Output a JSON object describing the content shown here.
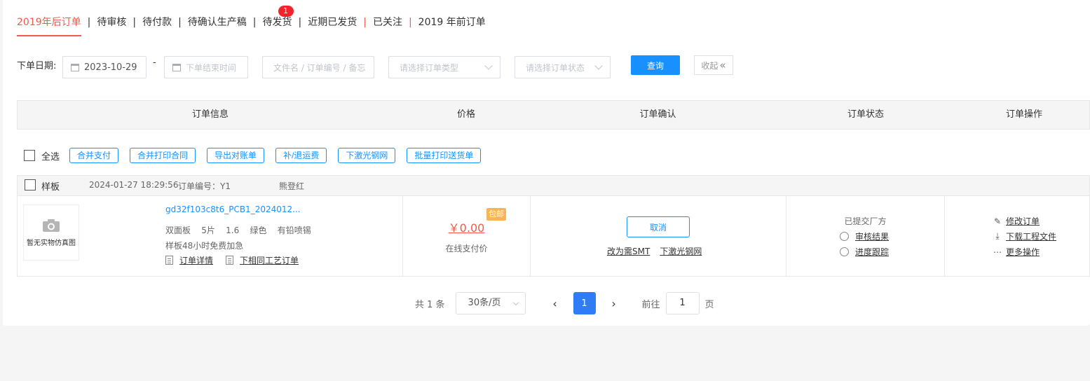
{
  "tabs": [
    {
      "label": "2019年后订单"
    },
    {
      "label": "待审核"
    },
    {
      "label": "待付款"
    },
    {
      "label": "待确认生产稿"
    },
    {
      "label": "待发货",
      "badge": "1"
    },
    {
      "label": "近期已发货"
    },
    {
      "label": "已关注"
    },
    {
      "label": "2019 年前订单"
    }
  ],
  "filters": {
    "date_label": "下单日期:",
    "start_date": "2023-10-29",
    "date_separator": "-",
    "end_placeholder": "下单结束时间",
    "keyword_placeholder": "文件名 / 订单编号 / 备忘",
    "order_type_placeholder": "请选择订单类型",
    "order_status_placeholder": "请选择订单状态",
    "query_label": "查询",
    "collapse_label": "收起"
  },
  "table": {
    "headers": [
      "订单信息",
      "价格",
      "订单确认",
      "订单状态",
      "订单操作"
    ]
  },
  "toolbar": {
    "select_all": "全选",
    "buttons": [
      "合并支付",
      "合并打印合同",
      "导出对账单",
      "补/退运费",
      "下激光钢网",
      "批量打印送货单"
    ]
  },
  "order": {
    "type": "样板",
    "datetime": "2024-01-27 18:29:56",
    "order_no": "订单编号：Y1",
    "owner": "熊登红",
    "thumb_text": "暂无实物仿真图",
    "product_name": "gd32f103c8t6_PCB1_2024012...",
    "spec": "双面板    5片    1.6    绿色    有铅喷锡",
    "note": "样板48小时免费加急",
    "detail_link": "订单详情",
    "same_process_link": "下相同工艺订单",
    "price": "￥0.00",
    "free_shipping_badge": "包邮",
    "pay_method": "在线支付价",
    "cancel_label": "取消",
    "to_smt_link": "改为需SMT",
    "laser_stencil_link": "下激光钢网",
    "status": "已提交厂方",
    "review_result_link": "审核结果",
    "progress_link": "进度跟踪",
    "edit_link": "修改订单",
    "download_link": "下载工程文件",
    "more_link": "更多操作"
  },
  "pagination": {
    "total": "共 1 条",
    "page_size": "30条/页",
    "current_page": "1",
    "goto_label": "前往",
    "goto_value": "1",
    "page_suffix": "页"
  },
  "colors": {
    "accent_red": "#f05a4a",
    "primary_blue": "#1890ff",
    "badge_red": "#f5222d",
    "free_badge": "#f7b557"
  }
}
